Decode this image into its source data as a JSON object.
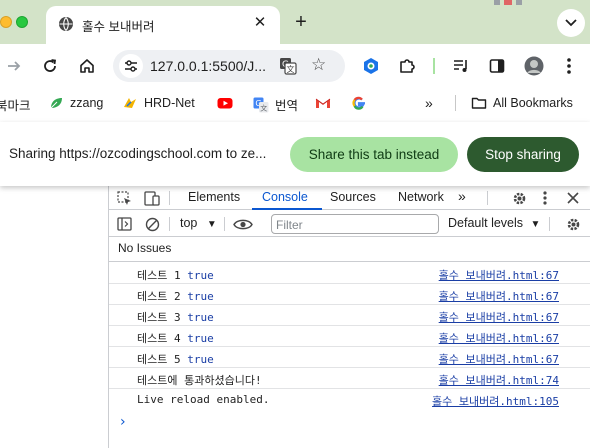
{
  "browser": {
    "tab": {
      "title": "홀수 보내버려"
    },
    "url": "127.0.0.1:5500/J...",
    "bookmarks": [
      {
        "label": "북마크"
      },
      {
        "label": "zzang"
      },
      {
        "label": "HRD-Net"
      },
      {
        "label": ""
      },
      {
        "label": "번역"
      },
      {
        "label": ""
      },
      {
        "label": ""
      }
    ],
    "all_bookmarks_label": "All Bookmarks"
  },
  "sharing_bar": {
    "message": "Sharing https://ozcodingschool.com to ze...",
    "switch_label": "Share this tab instead",
    "stop_label": "Stop sharing"
  },
  "devtools": {
    "tabs": [
      "Elements",
      "Console",
      "Sources",
      "Network"
    ],
    "active_tab": "Console",
    "context": "top",
    "filter_placeholder": "Filter",
    "levels": "Default levels",
    "issues": "No Issues",
    "logs": [
      {
        "text": "테스트 1",
        "value": "true",
        "source": "홀수 보내버려.html:67"
      },
      {
        "text": "테스트 2",
        "value": "true",
        "source": "홀수 보내버려.html:67"
      },
      {
        "text": "테스트 3",
        "value": "true",
        "source": "홀수 보내버려.html:67"
      },
      {
        "text": "테스트 4",
        "value": "true",
        "source": "홀수 보내버려.html:67"
      },
      {
        "text": "테스트 5",
        "value": "true",
        "source": "홀수 보내버려.html:67"
      },
      {
        "text": "테스트에 통과하셨습니다!",
        "value": "",
        "source": "홀수 보내버려.html:74"
      },
      {
        "text": "Live reload enabled.",
        "value": "",
        "source": "홀수 보내버려.html:105"
      }
    ],
    "prompt_glyph": "›"
  },
  "colors": {
    "tabstrip": "#d3e3c8",
    "switch_button": "#a8e3a2",
    "stop_button": "#2d5a2f",
    "accent": "#0b57d0",
    "link": "#1a3ea5"
  }
}
